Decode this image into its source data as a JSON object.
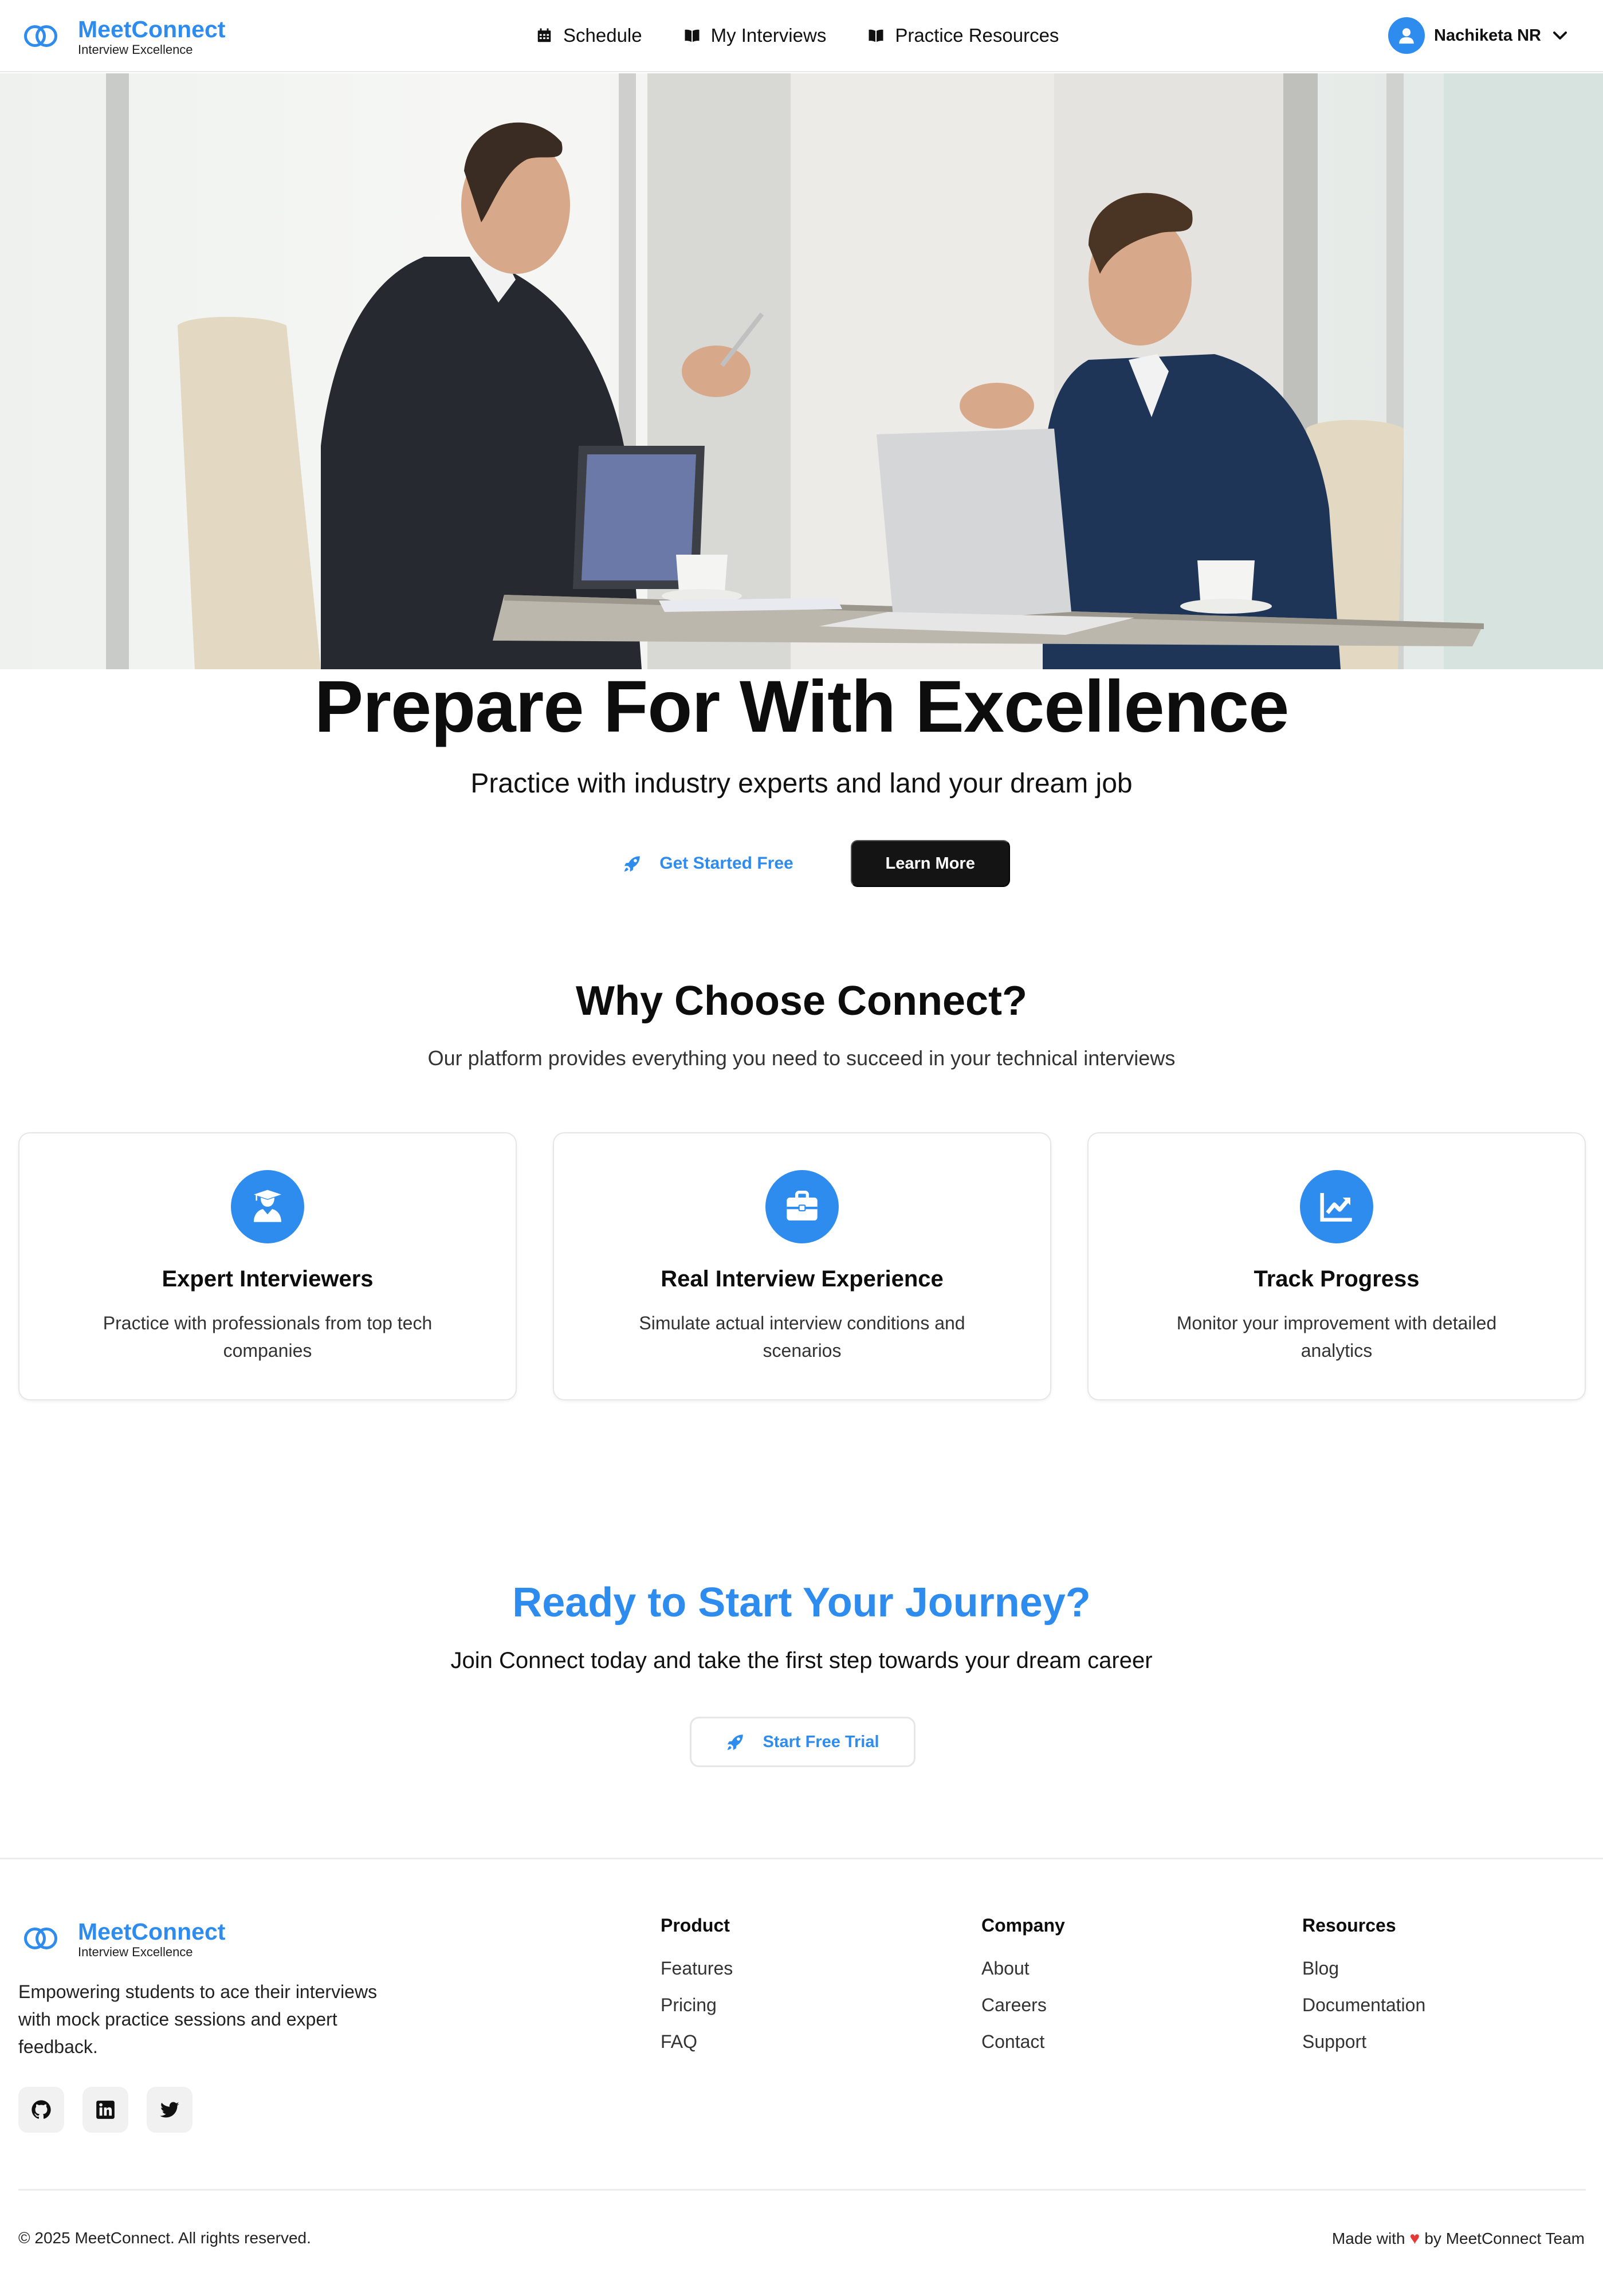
{
  "brand": {
    "name": "MeetConnect",
    "tagline": "Interview Excellence"
  },
  "nav": {
    "items": [
      {
        "label": "Schedule",
        "icon": "calendar-icon"
      },
      {
        "label": "My Interviews",
        "icon": "book-open-icon"
      },
      {
        "label": "Practice Resources",
        "icon": "book-open-icon"
      }
    ],
    "user_name": "Nachiketa NR"
  },
  "hero": {
    "title": "Prepare For With Excellence",
    "subtitle": "Practice with industry experts and land your dream job",
    "primary_button": "Get Started Free",
    "secondary_button": "Learn More"
  },
  "why": {
    "title": "Why Choose Connect?",
    "subtitle": "Our platform provides everything you need to succeed in your technical interviews",
    "cards": [
      {
        "title": "Expert Interviewers",
        "text": "Practice with professionals from top tech companies",
        "icon": "graduate-icon"
      },
      {
        "title": "Real Interview Experience",
        "text": "Simulate actual interview conditions and scenarios",
        "icon": "briefcase-icon"
      },
      {
        "title": "Track Progress",
        "text": "Monitor your improvement with detailed analytics",
        "icon": "chart-line-icon"
      }
    ]
  },
  "cta": {
    "title": "Ready to Start Your Journey?",
    "subtitle": "Join Connect today and take the first step towards your dream career",
    "button": "Start Free Trial"
  },
  "footer": {
    "description": "Empowering students to ace their interviews with mock practice sessions and expert feedback.",
    "columns": [
      {
        "title": "Product",
        "links": [
          "Features",
          "Pricing",
          "FAQ"
        ]
      },
      {
        "title": "Company",
        "links": [
          "About",
          "Careers",
          "Contact"
        ]
      },
      {
        "title": "Resources",
        "links": [
          "Blog",
          "Documentation",
          "Support"
        ]
      }
    ],
    "socials": [
      "github-icon",
      "linkedin-icon",
      "twitter-icon"
    ],
    "copyright": "© 2025 MeetConnect. All rights reserved.",
    "made_with_prefix": "Made with",
    "made_with_suffix": "by MeetConnect Team"
  },
  "colors": {
    "accent": "#2f8cef",
    "dark_button": "#141414",
    "heart": "#e53935"
  }
}
